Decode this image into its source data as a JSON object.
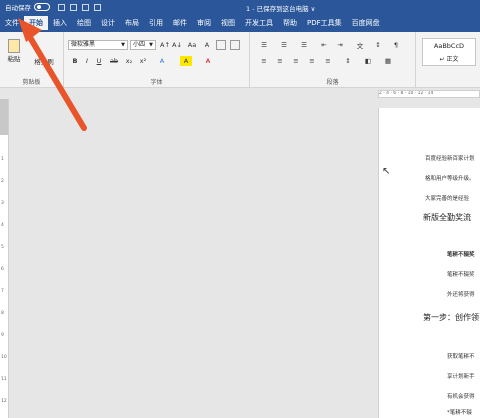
{
  "titlebar": {
    "autosave_label": "自动保存",
    "doc_title": "1 - 已保存到这台电脑 ∨"
  },
  "tabs": [
    "文件",
    "开始",
    "插入",
    "绘图",
    "设计",
    "布局",
    "引用",
    "邮件",
    "审阅",
    "视图",
    "开发工具",
    "帮助",
    "PDF工具集",
    "百度网盘"
  ],
  "ribbon": {
    "clipboard": {
      "paste_label": "粘贴",
      "format_painter": "格式刷",
      "group_label": "剪贴板"
    },
    "font": {
      "font_name": "微软雅黑",
      "font_size": "小四",
      "group_label": "字体",
      "buttons": [
        "A↑",
        "A↓",
        "Aa",
        "A"
      ],
      "format_buttons": [
        "B",
        "I",
        "U",
        "ab",
        "x₂",
        "x²",
        "A",
        "A",
        "A"
      ]
    },
    "paragraph": {
      "group_label": "段落"
    },
    "styles": {
      "normal_preview": "AaBbCcD",
      "normal_label": "正文"
    }
  },
  "ruler": {
    "ticks": "2  ·  4  ·  6  ·  8  ·  10 · 12 · 14"
  },
  "vruler": {
    "numbers": [
      "1",
      "2",
      "3",
      "4",
      "5",
      "6",
      "7",
      "8",
      "9",
      "10",
      "11",
      "12"
    ]
  },
  "document": {
    "lines": [
      "百度经验新百家计划",
      "格和用户等级升级。",
      "大家完善的是经验",
      "新版全勤奖流",
      "笔耕不辍奖",
      "笔耕不辍奖",
      "外还将获得",
      "第一步：创作领",
      "获取笔耕不",
      "享计划新手",
      "有机会获得",
      "*笔耕不辍"
    ]
  },
  "colors": {
    "accent": "#2b579a",
    "arrow": "#e8552a"
  }
}
